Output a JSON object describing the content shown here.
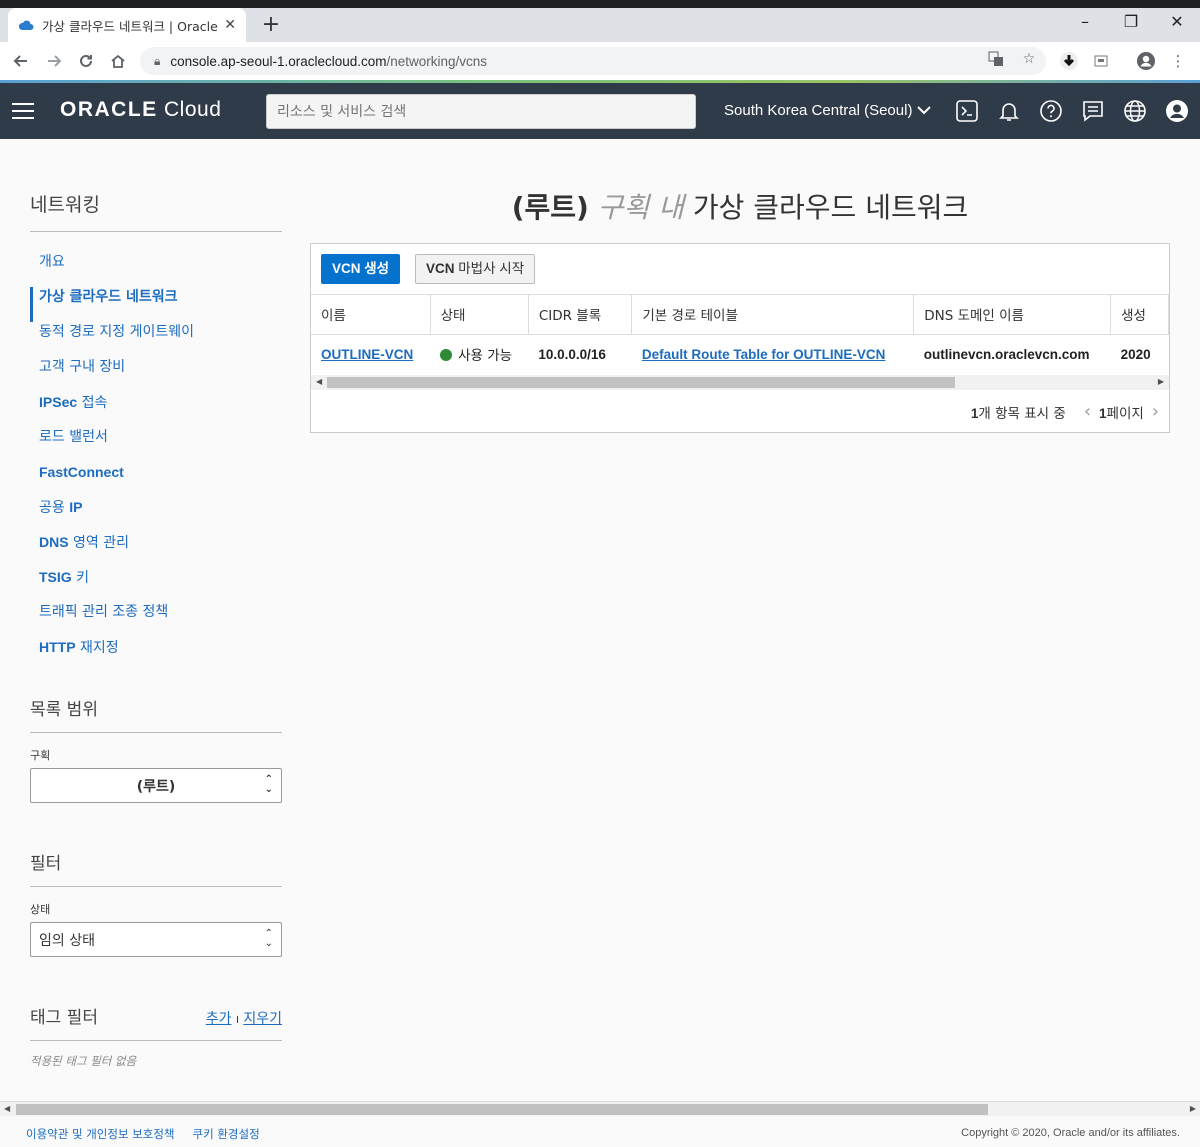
{
  "browser": {
    "tab_title": "가상 클라우드 네트워크 | Oracle",
    "new_tab": "+",
    "url_host": "console.ap-seoul-1.oraclecloud.com",
    "url_path": "/networking/vcns",
    "window_controls": [
      "–",
      "❐",
      "✕"
    ]
  },
  "header": {
    "logo_oracle": "ORACLE",
    "logo_cloud": " Cloud",
    "search_placeholder": "리소스 및 서비스 검색",
    "region": "South Korea Central (Seoul)"
  },
  "sidebar": {
    "title": "네트워킹",
    "items": [
      {
        "pre": "",
        "bold": "",
        "label": "개요"
      },
      {
        "pre": "",
        "bold": "",
        "label": "가상 클라우드 네트워크"
      },
      {
        "pre": "",
        "bold": "",
        "label": "동적 경로 지정 게이트웨이"
      },
      {
        "pre": "",
        "bold": "",
        "label": "고객 구내 장비"
      },
      {
        "pre": "",
        "bold": "IPSec",
        "label": " 접속"
      },
      {
        "pre": "",
        "bold": "",
        "label": "로드 밸런서"
      },
      {
        "pre": "",
        "bold": "FastConnect",
        "label": ""
      },
      {
        "pre": "공용 ",
        "bold": "IP",
        "label": ""
      },
      {
        "pre": "",
        "bold": "DNS",
        "label": " 영역 관리"
      },
      {
        "pre": "",
        "bold": "TSIG",
        "label": " 키"
      },
      {
        "pre": "",
        "bold": "",
        "label": "트래픽 관리 조종 정책"
      },
      {
        "pre": "",
        "bold": "HTTP",
        "label": " 재지정"
      }
    ],
    "list_scope_title": "목록 범위",
    "compartment_label": "구획",
    "compartment_value": "(루트)",
    "filter_title": "필터",
    "state_label": "상태",
    "state_value": "임의 상태",
    "tag_filter_title": "태그 필터",
    "tag_add": "추가",
    "tag_sep": "I",
    "tag_clear": "지우기",
    "tag_none": "적용된 태그 필터 없음"
  },
  "main": {
    "title_root": "(루트)",
    "title_in": " 구획 내 ",
    "title_rest": "가상 클라우드 네트워크",
    "create_bold": "VCN",
    "create_rest": " 생성",
    "wizard_bold": "VCN",
    "wizard_rest": " 마법사 시작",
    "columns": [
      "이름",
      "상태",
      "CIDR 블록",
      "기본 경로 테이블",
      "DNS 도메인 이름",
      "생성"
    ],
    "rows": [
      {
        "name": "OUTLINE-VCN",
        "status": "사용 가능",
        "cidr": "10.0.0.0/16",
        "route_table": "Default Route Table for OUTLINE-VCN",
        "dns": "outlinevcn.oraclevcn.com",
        "created": "2020"
      }
    ],
    "pager_count_num": "1",
    "pager_count_text": "개 항목 표시 중",
    "pager_page_num": "1",
    "pager_page_text": "페이지"
  },
  "footer": {
    "privacy": "이용약관 및 개인정보 보호정책",
    "cookies": "쿠키 환경설정",
    "copyright": "Copyright © 2020, Oracle and/or its affiliates."
  },
  "colors": {
    "header_bg": "#2f3b48",
    "primary": "#0572ce",
    "link": "#1c6cc1",
    "status_green": "#2e8a34"
  }
}
